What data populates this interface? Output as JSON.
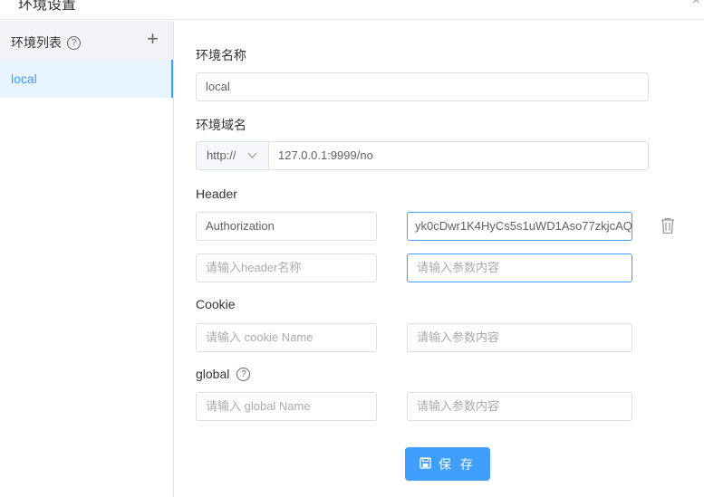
{
  "window": {
    "title": "环境设置",
    "close": "×"
  },
  "sidebar": {
    "title": "环境列表",
    "help": "?",
    "add": "+",
    "items": [
      {
        "label": "local",
        "active": true
      }
    ]
  },
  "form": {
    "env_name": {
      "label": "环境名称",
      "value": "local"
    },
    "env_domain": {
      "label": "环境域名",
      "protocol": "http://",
      "value": "127.0.0.1:9999/no"
    },
    "header": {
      "label": "Header",
      "rows": [
        {
          "key": "Authorization",
          "value": "yk0cDwr1K4HyCs5s1uWD1Aso77zkjcAQ"
        }
      ],
      "key_placeholder": "请输入header名称",
      "value_placeholder": "请输入参数内容"
    },
    "cookie": {
      "label": "Cookie",
      "key_placeholder": "请输入 cookie Name",
      "value_placeholder": "请输入参数内容"
    },
    "global": {
      "label": "global",
      "help": "?",
      "key_placeholder": "请输入 global Name",
      "value_placeholder": "请输入参数内容"
    }
  },
  "actions": {
    "save_label": "保 存"
  },
  "colors": {
    "accent": "#409eff",
    "sidebar_active_bg": "#e8f4ff"
  }
}
